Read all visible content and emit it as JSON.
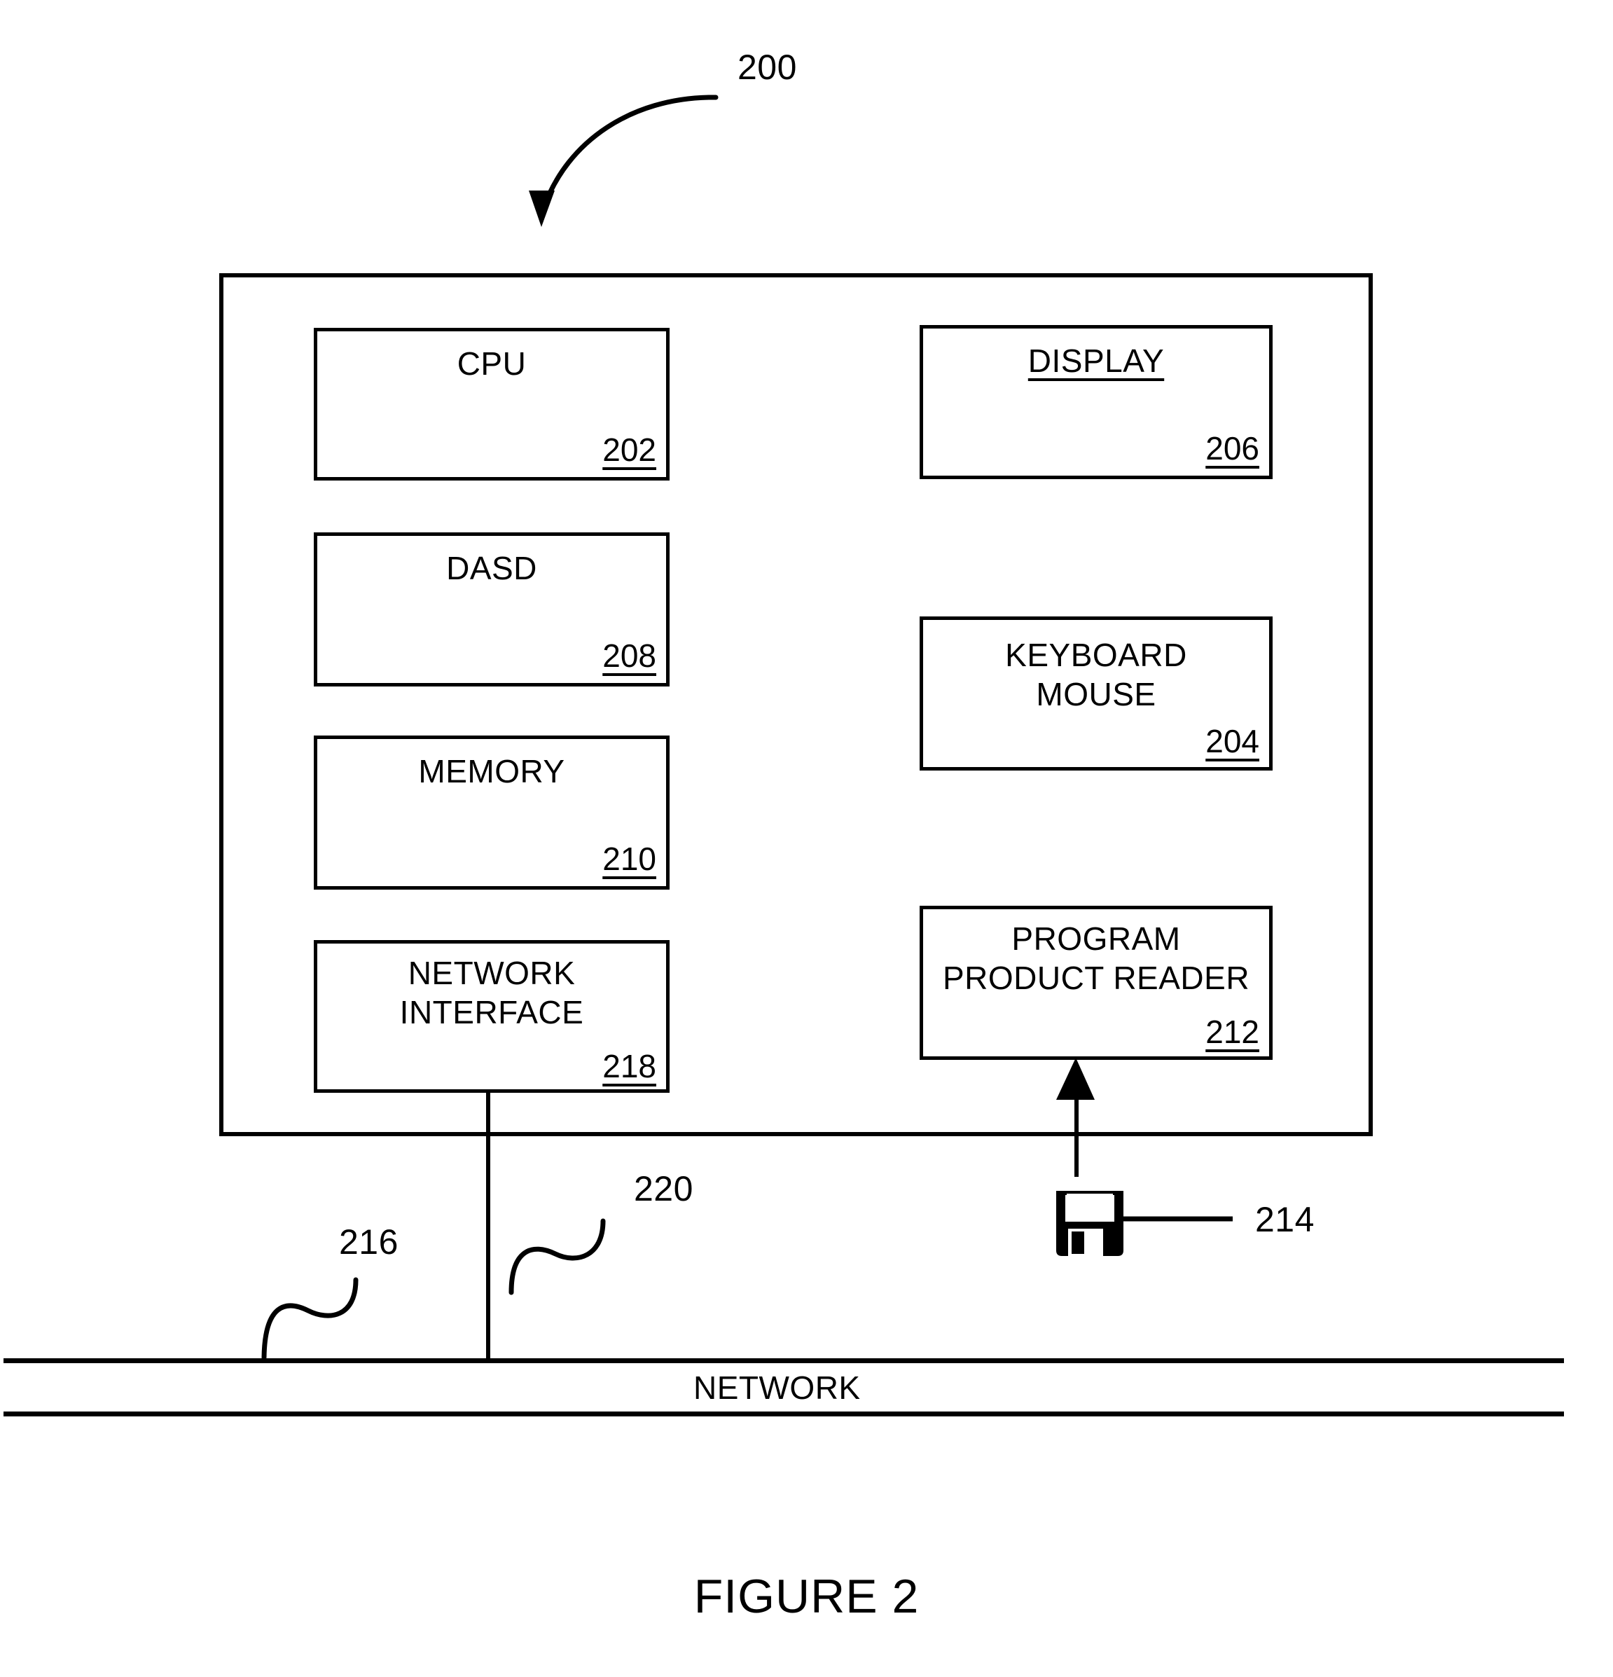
{
  "figure": {
    "caption": "FIGURE 2",
    "system_ref": "200"
  },
  "system": {
    "components": [
      {
        "id": "cpu",
        "title": "CPU",
        "ref": "202",
        "underline_title": false
      },
      {
        "id": "dasd",
        "title": "DASD",
        "ref": "208",
        "underline_title": false
      },
      {
        "id": "memory",
        "title": "MEMORY",
        "ref": "210",
        "underline_title": false
      },
      {
        "id": "netif",
        "title": "NETWORK\nINTERFACE",
        "ref": "218",
        "underline_title": false
      },
      {
        "id": "display",
        "title": "DISPLAY",
        "ref": "206",
        "underline_title": true
      },
      {
        "id": "keyboard",
        "title": "KEYBOARD\nMOUSE",
        "ref": "204",
        "underline_title": false
      },
      {
        "id": "reader",
        "title": "PROGRAM\nPRODUCT READER",
        "ref": "212",
        "underline_title": false
      }
    ]
  },
  "network": {
    "label": "NETWORK",
    "bus_ref": "216",
    "connection_ref": "220"
  },
  "media": {
    "floppy_ref": "214",
    "icon": "floppy-disk-icon"
  },
  "colors": {
    "ink": "#000000",
    "paper": "#ffffff"
  }
}
